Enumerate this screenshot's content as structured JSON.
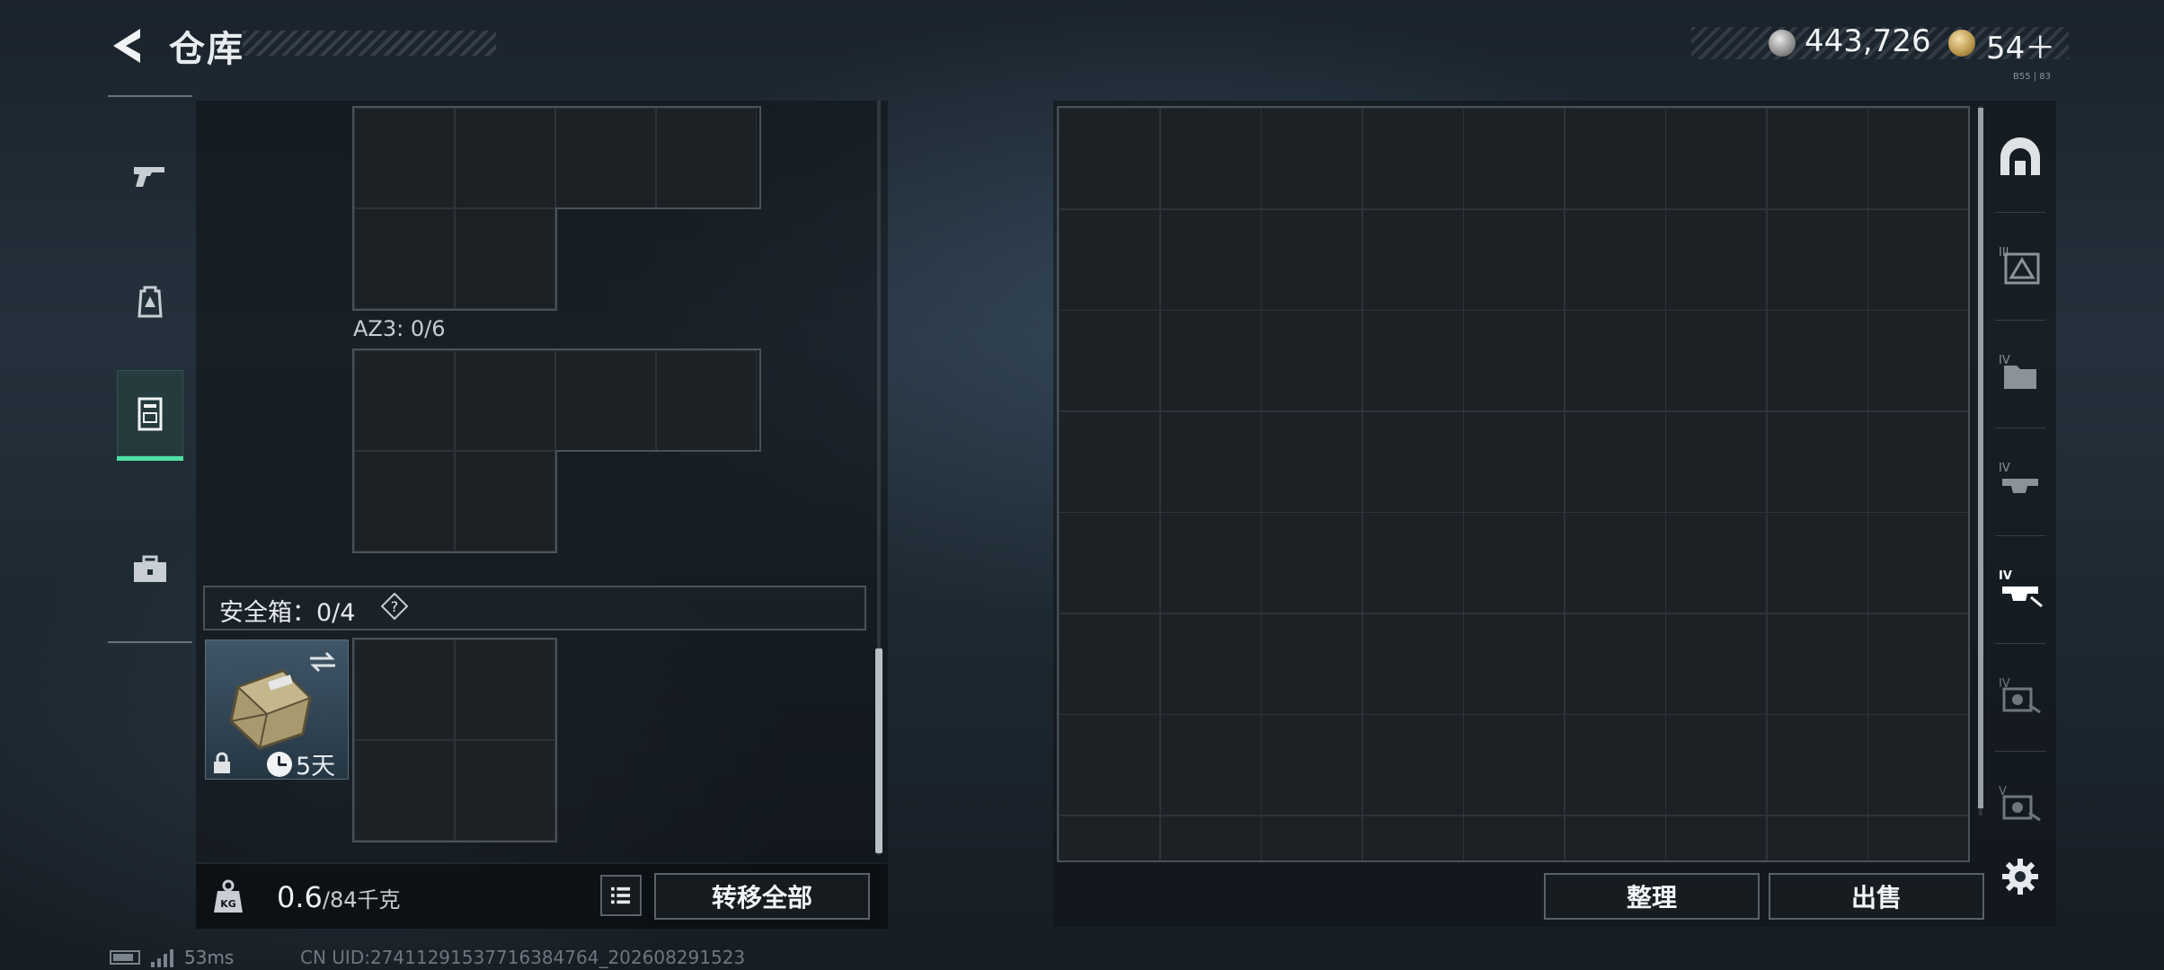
{
  "header": {
    "title": "仓库",
    "currency_silver": "443,726",
    "currency_gold": "54＋",
    "version_text": "B55 | 83"
  },
  "nav": {
    "items": [
      {
        "name": "weapons",
        "icon": "pistol-icon"
      },
      {
        "name": "gear",
        "icon": "backpack-icon"
      },
      {
        "name": "storage",
        "icon": "locker-icon",
        "active": true
      },
      {
        "name": "toolbox",
        "icon": "toolbox-icon"
      }
    ]
  },
  "left_panel": {
    "container_label": "AZ3: 0/6",
    "safe_box_label": "安全箱：0/4",
    "safe_box_help": "?",
    "case_timer": "5天",
    "weight_value": "0.6",
    "weight_max": "/84千克",
    "transfer_all_label": "转移全部"
  },
  "right_panel": {
    "sort_label": "整理",
    "sell_label": "出售",
    "categories": [
      {
        "icon": "armor-arch-icon"
      },
      {
        "icon": "rank-iii-icon",
        "label": "III"
      },
      {
        "icon": "rank-iv-folder-icon",
        "label": "IV"
      },
      {
        "icon": "rank-iv-rig-icon",
        "label": "IV"
      },
      {
        "icon": "rank-iv-rig-selected-icon",
        "label": "IV",
        "active": true
      },
      {
        "icon": "rank-iv-gun-icon",
        "label": "IV"
      },
      {
        "icon": "rank-v-gun-icon",
        "label": "V"
      }
    ]
  },
  "footer": {
    "ping": "53ms",
    "uid": "CN UID:27411291537716384764_202608291523"
  },
  "colors": {
    "accent_green": "#4fe0a6",
    "panel_bg": "#1c2125",
    "grid_border": "#2d3338"
  }
}
